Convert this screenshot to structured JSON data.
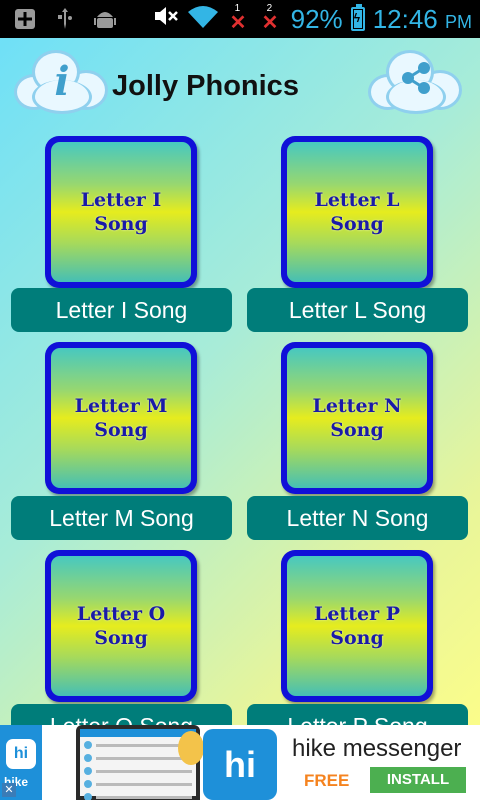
{
  "status_bar": {
    "battery_percent": "92%",
    "time": "12:46",
    "ampm": "PM",
    "sim1_number": "1",
    "sim2_number": "2",
    "icons": [
      "add-notification-icon",
      "usb-icon",
      "android-debug-icon",
      "mute-icon",
      "wifi-icon",
      "sim1-no-signal-icon",
      "sim2-no-signal-icon",
      "battery-charging-icon"
    ]
  },
  "header": {
    "title": "Jolly Phonics",
    "info_icon": "info-icon",
    "share_icon": "share-icon"
  },
  "songs": [
    {
      "tile_line1": "Letter I",
      "tile_line2": "Song",
      "label": "Letter I Song"
    },
    {
      "tile_line1": "Letter L",
      "tile_line2": "Song",
      "label": "Letter L Song"
    },
    {
      "tile_line1": "Letter M",
      "tile_line2": "Song",
      "label": "Letter M Song"
    },
    {
      "tile_line1": "Letter N",
      "tile_line2": "Song",
      "label": "Letter N Song"
    },
    {
      "tile_line1": "Letter O",
      "tile_line2": "Song",
      "label": "Letter O Song"
    },
    {
      "tile_line1": "Letter P",
      "tile_line2": "Song",
      "label": "Letter P Song"
    }
  ],
  "ad": {
    "brand": "hike",
    "title": "hike messenger",
    "free": "FREE",
    "install": "INSTALL",
    "logo": "hi"
  },
  "colors": {
    "status_accent": "#33b5e5",
    "tile_border": "#1010d8",
    "label_button": "#007d7a",
    "ad_blue": "#1e90d9",
    "install_green": "#4caf50",
    "free_orange": "#f5831f"
  }
}
